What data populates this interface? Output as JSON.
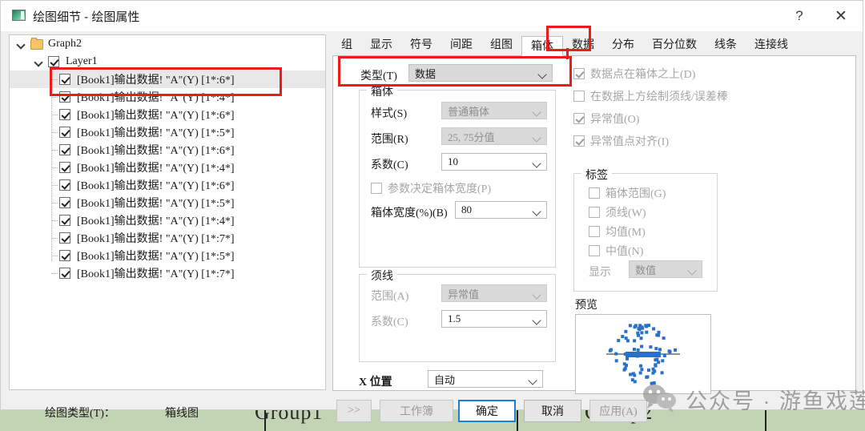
{
  "window": {
    "title": "绘图细节 - 绘图属性",
    "icon": "plot-details-icon",
    "help_label": "?",
    "close_label": "✕"
  },
  "tree": {
    "root": {
      "label": "Graph2",
      "icon": "folder-icon",
      "expanded": true
    },
    "layer": {
      "label": "Layer1",
      "checked": true,
      "expanded": true
    },
    "items": [
      {
        "label": "[Book1]输出数据! \"A\"(Y)  [1*:6*]",
        "checked": true,
        "selected": true
      },
      {
        "label": "[Book1]输出数据! \"A\"(Y)  [1*:4*]",
        "checked": true,
        "selected": false
      },
      {
        "label": "[Book1]输出数据! \"A\"(Y)  [1*:6*]",
        "checked": true,
        "selected": false
      },
      {
        "label": "[Book1]输出数据! \"A\"(Y)  [1*:5*]",
        "checked": true,
        "selected": false
      },
      {
        "label": "[Book1]输出数据! \"A\"(Y)  [1*:6*]",
        "checked": true,
        "selected": false
      },
      {
        "label": "[Book1]输出数据! \"A\"(Y)  [1*:4*]",
        "checked": true,
        "selected": false
      },
      {
        "label": "[Book1]输出数据! \"A\"(Y)  [1*:6*]",
        "checked": true,
        "selected": false
      },
      {
        "label": "[Book1]输出数据! \"A\"(Y)  [1*:5*]",
        "checked": true,
        "selected": false
      },
      {
        "label": "[Book1]输出数据! \"A\"(Y)  [1*:4*]",
        "checked": true,
        "selected": false
      },
      {
        "label": "[Book1]输出数据! \"A\"(Y)  [1*:7*]",
        "checked": true,
        "selected": false
      },
      {
        "label": "[Book1]输出数据! \"A\"(Y)  [1*:5*]",
        "checked": true,
        "selected": false
      },
      {
        "label": "[Book1]输出数据! \"A\"(Y)  [1*:7*]",
        "checked": true,
        "selected": false
      }
    ]
  },
  "tabs": [
    {
      "label": "组",
      "active": false
    },
    {
      "label": "显示",
      "active": false
    },
    {
      "label": "符号",
      "active": false
    },
    {
      "label": "间距",
      "active": false
    },
    {
      "label": "组图",
      "active": false
    },
    {
      "label": "箱体",
      "active": true
    },
    {
      "label": "数据",
      "active": false
    },
    {
      "label": "分布",
      "active": false
    },
    {
      "label": "百分位数",
      "active": false
    },
    {
      "label": "线条",
      "active": false
    },
    {
      "label": "连接线",
      "active": false
    }
  ],
  "panel": {
    "type_row": {
      "label": "类型(T)",
      "value": "数据",
      "disabled": false
    },
    "box_group": {
      "title": "箱体",
      "style": {
        "label": "样式(S)",
        "value": "普通箱体",
        "disabled": true
      },
      "range": {
        "label": "范围(R)",
        "value": "25, 75分值",
        "disabled": true
      },
      "coef": {
        "label": "系数(C)",
        "value": "10",
        "disabled": false
      },
      "param_width_chk": {
        "label": "参数决定箱体宽度(P)",
        "checked": false
      },
      "box_width": {
        "label": "箱体宽度(%)(B)",
        "value": "80",
        "disabled": false
      }
    },
    "whisker_group": {
      "title": "须线",
      "range": {
        "label": "范围(A)",
        "value": "异常值",
        "disabled": true
      },
      "coef": {
        "label": "系数(C)",
        "value": "1.5",
        "disabled": false
      }
    },
    "x_position": {
      "label": "X 位置",
      "value": "自动",
      "disabled": false
    },
    "checkboxes": [
      {
        "label": "数据点在箱体之上(D)",
        "checked": true
      },
      {
        "label": "在数据上方绘制须线/误差棒",
        "checked": false
      },
      {
        "label": "异常值(O)",
        "checked": true
      },
      {
        "label": "异常值点对齐(I)",
        "checked": true
      }
    ],
    "labels_group": {
      "title": "标签",
      "items": [
        {
          "label": "箱体范围(G)",
          "checked": false
        },
        {
          "label": "须线(W)",
          "checked": false
        },
        {
          "label": "均值(M)",
          "checked": false
        },
        {
          "label": "中值(N)",
          "checked": false
        }
      ],
      "display": {
        "label": "显示",
        "value": "数值",
        "disabled": true
      }
    },
    "preview": {
      "label": "预览",
      "point_color": "#2a6fc9",
      "line_color": "#6b6b6b"
    }
  },
  "bottom": {
    "plot_type_label": "绘图类型(T)：",
    "plot_type_value": "箱线图",
    "expand_label": ">>",
    "workbook_label": "工作簿",
    "ok_label": "确定",
    "cancel_label": "取消",
    "apply_label": "应用(A)"
  },
  "watermark": {
    "text": "公众号 · 游鱼戏莲",
    "icon": "wechat-icon"
  },
  "background": {
    "group1": "Group1",
    "group2": "Group2"
  }
}
